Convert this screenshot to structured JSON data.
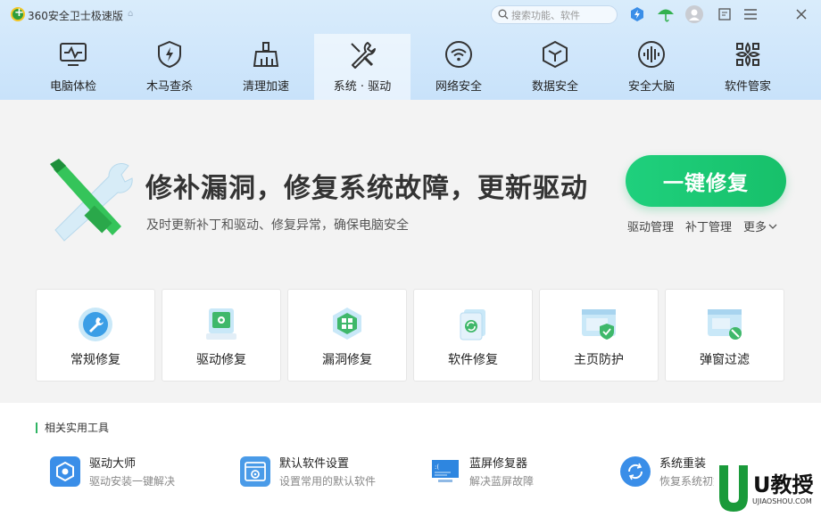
{
  "app": {
    "title": "360安全卫士极速版"
  },
  "search": {
    "placeholder": "搜索功能、软件"
  },
  "titlebar_icons": [
    "speed-icon",
    "umbrella-icon",
    "avatar",
    "feedback-icon",
    "menu-icon",
    "close-icon"
  ],
  "nav": {
    "tabs": [
      {
        "label": "电脑体检",
        "icon": "monitor-check-icon"
      },
      {
        "label": "木马查杀",
        "icon": "shield-lightning-icon"
      },
      {
        "label": "清理加速",
        "icon": "broom-icon"
      },
      {
        "label": "系统 · 驱动",
        "icon": "tools-icon",
        "active": true
      },
      {
        "label": "网络安全",
        "icon": "wifi-icon"
      },
      {
        "label": "数据安全",
        "icon": "hexagon-icon"
      },
      {
        "label": "安全大脑",
        "icon": "brain-icon"
      },
      {
        "label": "软件管家",
        "icon": "apps-icon"
      }
    ]
  },
  "hero": {
    "headline": "修补漏洞，修复系统故障，更新驱动",
    "subline": "及时更新补丁和驱动、修复异常，确保电脑安全",
    "button": "一键修复",
    "links": {
      "driver": "驱动管理",
      "patch": "补丁管理",
      "more": "更多"
    }
  },
  "cards": [
    {
      "label": "常规修复",
      "icon": "wrench-circle-icon"
    },
    {
      "label": "驱动修复",
      "icon": "driver-disk-icon"
    },
    {
      "label": "漏洞修复",
      "icon": "windows-shield-icon"
    },
    {
      "label": "软件修复",
      "icon": "software-refresh-icon"
    },
    {
      "label": "主页防护",
      "icon": "homepage-shield-icon"
    },
    {
      "label": "弹窗过滤",
      "icon": "popup-block-icon"
    }
  ],
  "tools": {
    "heading": "相关实用工具",
    "items": [
      {
        "name": "驱动大师",
        "desc": "驱动安装一键解决",
        "icon": "driver-master-icon"
      },
      {
        "name": "默认软件设置",
        "desc": "设置常用的默认软件",
        "icon": "default-software-icon"
      },
      {
        "name": "蓝屏修复器",
        "desc": "解决蓝屏故障",
        "icon": "bluescreen-icon"
      },
      {
        "name": "系统重装",
        "desc": "恢复系统初始状态",
        "icon": "reinstall-icon"
      }
    ]
  },
  "watermark": {
    "text": "U教授",
    "sub": "UJIAOSHOU.COM"
  },
  "colors": {
    "accent_green": "#1fd07d",
    "nav_bg": "#d2e7fb",
    "body_bg": "#f3f3f3"
  }
}
